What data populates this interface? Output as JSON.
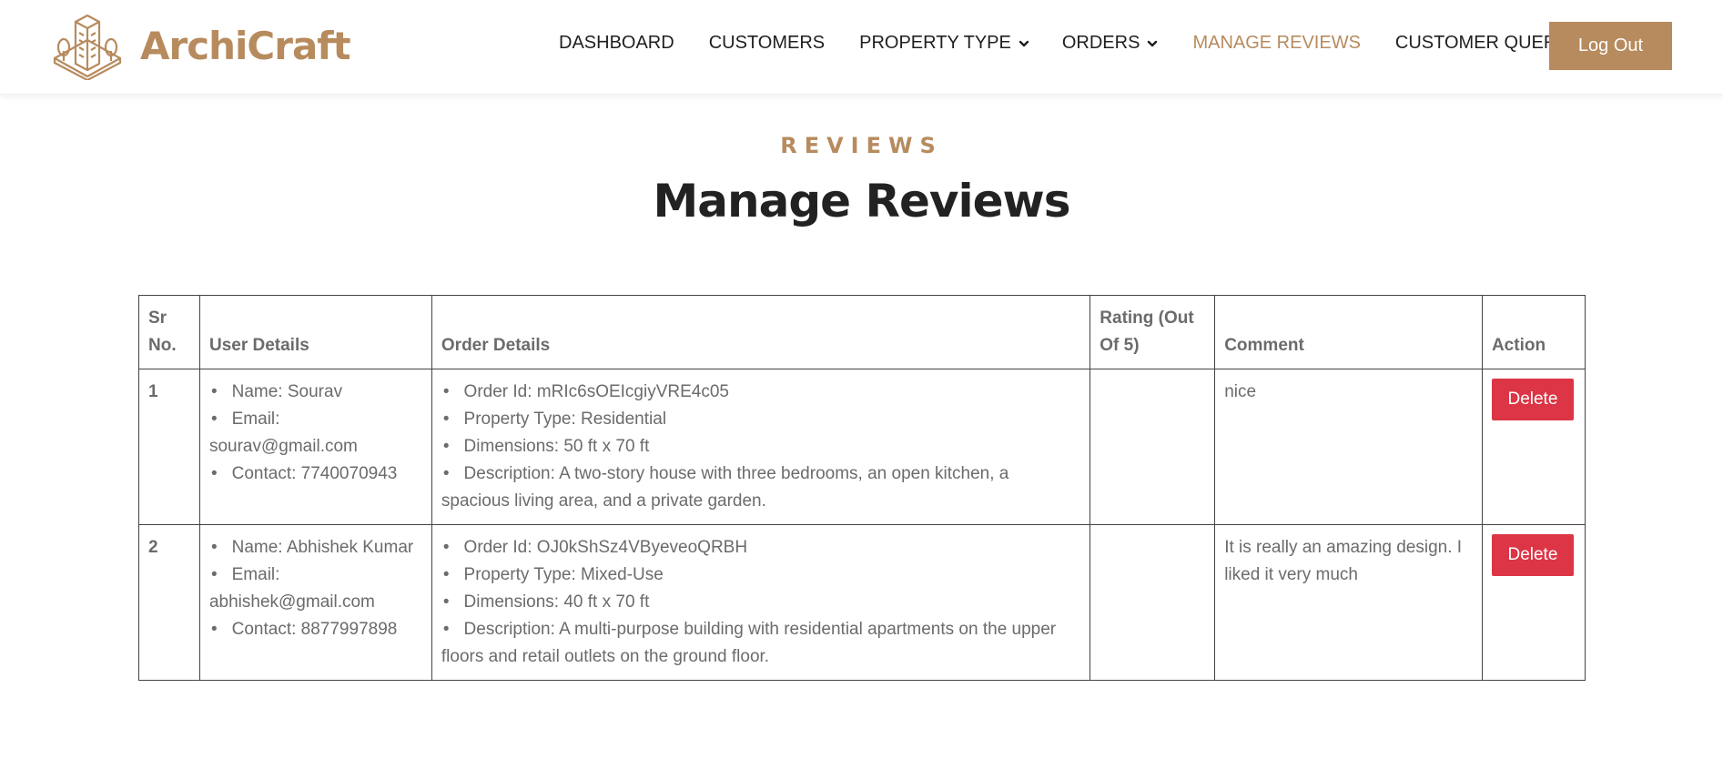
{
  "brand": {
    "name": "ArchiCraft",
    "logo_icon": "building-logo-icon",
    "color": "#b78b5e"
  },
  "nav": {
    "items": [
      {
        "label": "DASHBOARD",
        "dropdown": false,
        "active": false
      },
      {
        "label": "CUSTOMERS",
        "dropdown": false,
        "active": false
      },
      {
        "label": "PROPERTY TYPE",
        "dropdown": true,
        "active": false
      },
      {
        "label": "ORDERS",
        "dropdown": true,
        "active": false
      },
      {
        "label": "MANAGE REVIEWS",
        "dropdown": false,
        "active": true
      },
      {
        "label": "CUSTOMER QUERIES",
        "dropdown": false,
        "active": false
      }
    ],
    "logout_label": "Log Out"
  },
  "section": {
    "subtitle": "REVIEWS",
    "title": "Manage Reviews"
  },
  "table": {
    "headers": [
      "Sr No.",
      "User Details",
      "Order Details",
      "Rating (Out Of 5)",
      "Comment",
      "Action"
    ],
    "rows": [
      {
        "sr": "1",
        "user": [
          "Name: Sourav",
          "Email: sourav@gmail.com",
          "Contact: 7740070943"
        ],
        "order": [
          "Order Id: mRIc6sOEIcgiyVRE4c05",
          "Property Type: Residential",
          "Dimensions: 50 ft x 70 ft",
          "Description: A two-story house with three bedrooms, an open kitchen, a spacious living area, and a private garden."
        ],
        "rating": "",
        "comment": "nice",
        "action_label": "Delete"
      },
      {
        "sr": "2",
        "user": [
          "Name: Abhishek Kumar",
          "Email: abhishek@gmail.com",
          "Contact: 8877997898"
        ],
        "order": [
          "Order Id: OJ0kShSz4VByeveoQRBH",
          "Property Type: Mixed-Use",
          "Dimensions: 40 ft x 70 ft",
          "Description: A multi-purpose building with residential apartments on the upper floors and retail outlets on the ground floor."
        ],
        "rating": "",
        "comment": "It is really an amazing design. I liked it very much",
        "action_label": "Delete"
      }
    ]
  },
  "colors": {
    "accent": "#b78b5e",
    "danger": "#dc3545",
    "heading": "#222222",
    "text": "#6b6b6b"
  }
}
